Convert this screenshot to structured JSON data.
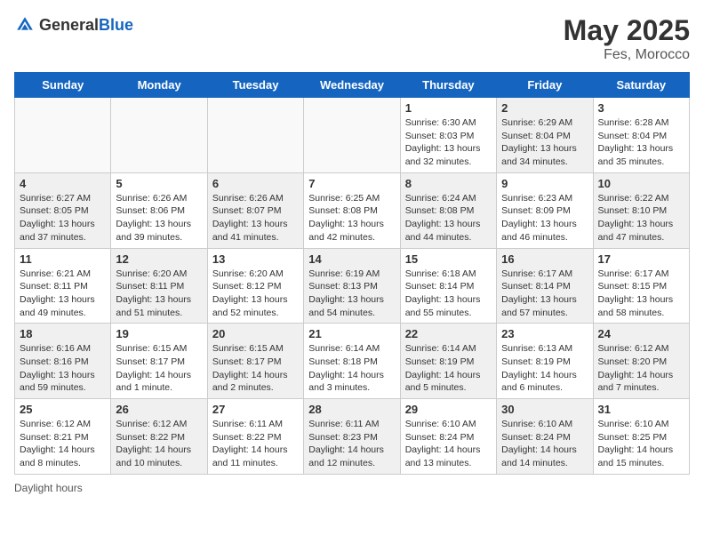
{
  "header": {
    "logo_general": "General",
    "logo_blue": "Blue",
    "month_year": "May 2025",
    "location": "Fes, Morocco"
  },
  "footer": {
    "label": "Daylight hours"
  },
  "weekdays": [
    "Sunday",
    "Monday",
    "Tuesday",
    "Wednesday",
    "Thursday",
    "Friday",
    "Saturday"
  ],
  "weeks": [
    [
      {
        "day": "",
        "info": "",
        "empty": true
      },
      {
        "day": "",
        "info": "",
        "empty": true
      },
      {
        "day": "",
        "info": "",
        "empty": true
      },
      {
        "day": "",
        "info": "",
        "empty": true
      },
      {
        "day": "1",
        "info": "Sunrise: 6:30 AM\nSunset: 8:03 PM\nDaylight: 13 hours\nand 32 minutes.",
        "empty": false,
        "shaded": false
      },
      {
        "day": "2",
        "info": "Sunrise: 6:29 AM\nSunset: 8:04 PM\nDaylight: 13 hours\nand 34 minutes.",
        "empty": false,
        "shaded": true
      },
      {
        "day": "3",
        "info": "Sunrise: 6:28 AM\nSunset: 8:04 PM\nDaylight: 13 hours\nand 35 minutes.",
        "empty": false,
        "shaded": false
      }
    ],
    [
      {
        "day": "4",
        "info": "Sunrise: 6:27 AM\nSunset: 8:05 PM\nDaylight: 13 hours\nand 37 minutes.",
        "empty": false,
        "shaded": true
      },
      {
        "day": "5",
        "info": "Sunrise: 6:26 AM\nSunset: 8:06 PM\nDaylight: 13 hours\nand 39 minutes.",
        "empty": false,
        "shaded": false
      },
      {
        "day": "6",
        "info": "Sunrise: 6:26 AM\nSunset: 8:07 PM\nDaylight: 13 hours\nand 41 minutes.",
        "empty": false,
        "shaded": true
      },
      {
        "day": "7",
        "info": "Sunrise: 6:25 AM\nSunset: 8:08 PM\nDaylight: 13 hours\nand 42 minutes.",
        "empty": false,
        "shaded": false
      },
      {
        "day": "8",
        "info": "Sunrise: 6:24 AM\nSunset: 8:08 PM\nDaylight: 13 hours\nand 44 minutes.",
        "empty": false,
        "shaded": true
      },
      {
        "day": "9",
        "info": "Sunrise: 6:23 AM\nSunset: 8:09 PM\nDaylight: 13 hours\nand 46 minutes.",
        "empty": false,
        "shaded": false
      },
      {
        "day": "10",
        "info": "Sunrise: 6:22 AM\nSunset: 8:10 PM\nDaylight: 13 hours\nand 47 minutes.",
        "empty": false,
        "shaded": true
      }
    ],
    [
      {
        "day": "11",
        "info": "Sunrise: 6:21 AM\nSunset: 8:11 PM\nDaylight: 13 hours\nand 49 minutes.",
        "empty": false,
        "shaded": false
      },
      {
        "day": "12",
        "info": "Sunrise: 6:20 AM\nSunset: 8:11 PM\nDaylight: 13 hours\nand 51 minutes.",
        "empty": false,
        "shaded": true
      },
      {
        "day": "13",
        "info": "Sunrise: 6:20 AM\nSunset: 8:12 PM\nDaylight: 13 hours\nand 52 minutes.",
        "empty": false,
        "shaded": false
      },
      {
        "day": "14",
        "info": "Sunrise: 6:19 AM\nSunset: 8:13 PM\nDaylight: 13 hours\nand 54 minutes.",
        "empty": false,
        "shaded": true
      },
      {
        "day": "15",
        "info": "Sunrise: 6:18 AM\nSunset: 8:14 PM\nDaylight: 13 hours\nand 55 minutes.",
        "empty": false,
        "shaded": false
      },
      {
        "day": "16",
        "info": "Sunrise: 6:17 AM\nSunset: 8:14 PM\nDaylight: 13 hours\nand 57 minutes.",
        "empty": false,
        "shaded": true
      },
      {
        "day": "17",
        "info": "Sunrise: 6:17 AM\nSunset: 8:15 PM\nDaylight: 13 hours\nand 58 minutes.",
        "empty": false,
        "shaded": false
      }
    ],
    [
      {
        "day": "18",
        "info": "Sunrise: 6:16 AM\nSunset: 8:16 PM\nDaylight: 13 hours\nand 59 minutes.",
        "empty": false,
        "shaded": true
      },
      {
        "day": "19",
        "info": "Sunrise: 6:15 AM\nSunset: 8:17 PM\nDaylight: 14 hours\nand 1 minute.",
        "empty": false,
        "shaded": false
      },
      {
        "day": "20",
        "info": "Sunrise: 6:15 AM\nSunset: 8:17 PM\nDaylight: 14 hours\nand 2 minutes.",
        "empty": false,
        "shaded": true
      },
      {
        "day": "21",
        "info": "Sunrise: 6:14 AM\nSunset: 8:18 PM\nDaylight: 14 hours\nand 3 minutes.",
        "empty": false,
        "shaded": false
      },
      {
        "day": "22",
        "info": "Sunrise: 6:14 AM\nSunset: 8:19 PM\nDaylight: 14 hours\nand 5 minutes.",
        "empty": false,
        "shaded": true
      },
      {
        "day": "23",
        "info": "Sunrise: 6:13 AM\nSunset: 8:19 PM\nDaylight: 14 hours\nand 6 minutes.",
        "empty": false,
        "shaded": false
      },
      {
        "day": "24",
        "info": "Sunrise: 6:12 AM\nSunset: 8:20 PM\nDaylight: 14 hours\nand 7 minutes.",
        "empty": false,
        "shaded": true
      }
    ],
    [
      {
        "day": "25",
        "info": "Sunrise: 6:12 AM\nSunset: 8:21 PM\nDaylight: 14 hours\nand 8 minutes.",
        "empty": false,
        "shaded": false
      },
      {
        "day": "26",
        "info": "Sunrise: 6:12 AM\nSunset: 8:22 PM\nDaylight: 14 hours\nand 10 minutes.",
        "empty": false,
        "shaded": true
      },
      {
        "day": "27",
        "info": "Sunrise: 6:11 AM\nSunset: 8:22 PM\nDaylight: 14 hours\nand 11 minutes.",
        "empty": false,
        "shaded": false
      },
      {
        "day": "28",
        "info": "Sunrise: 6:11 AM\nSunset: 8:23 PM\nDaylight: 14 hours\nand 12 minutes.",
        "empty": false,
        "shaded": true
      },
      {
        "day": "29",
        "info": "Sunrise: 6:10 AM\nSunset: 8:24 PM\nDaylight: 14 hours\nand 13 minutes.",
        "empty": false,
        "shaded": false
      },
      {
        "day": "30",
        "info": "Sunrise: 6:10 AM\nSunset: 8:24 PM\nDaylight: 14 hours\nand 14 minutes.",
        "empty": false,
        "shaded": true
      },
      {
        "day": "31",
        "info": "Sunrise: 6:10 AM\nSunset: 8:25 PM\nDaylight: 14 hours\nand 15 minutes.",
        "empty": false,
        "shaded": false
      }
    ]
  ]
}
